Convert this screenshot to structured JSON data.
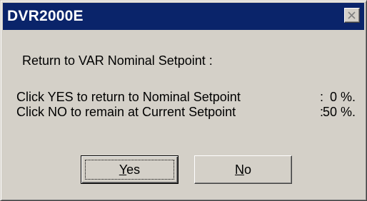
{
  "window": {
    "title": "DVR2000E"
  },
  "message": {
    "heading": "Return to VAR Nominal Setpoint :",
    "rows": [
      {
        "text": "Click YES to return to Nominal Setpoint",
        "colon": ":",
        "value": "0 %."
      },
      {
        "text": "Click NO to remain at Current Setpoint",
        "colon": ":",
        "value": "50 %."
      }
    ]
  },
  "buttons": {
    "yes_hotkey": "Y",
    "yes_rest": "es",
    "no_hotkey": "N",
    "no_rest": "o"
  },
  "icons": {
    "close": "close-icon"
  },
  "colors": {
    "titlebar": "#0a246a",
    "face": "#d4d0c8"
  }
}
